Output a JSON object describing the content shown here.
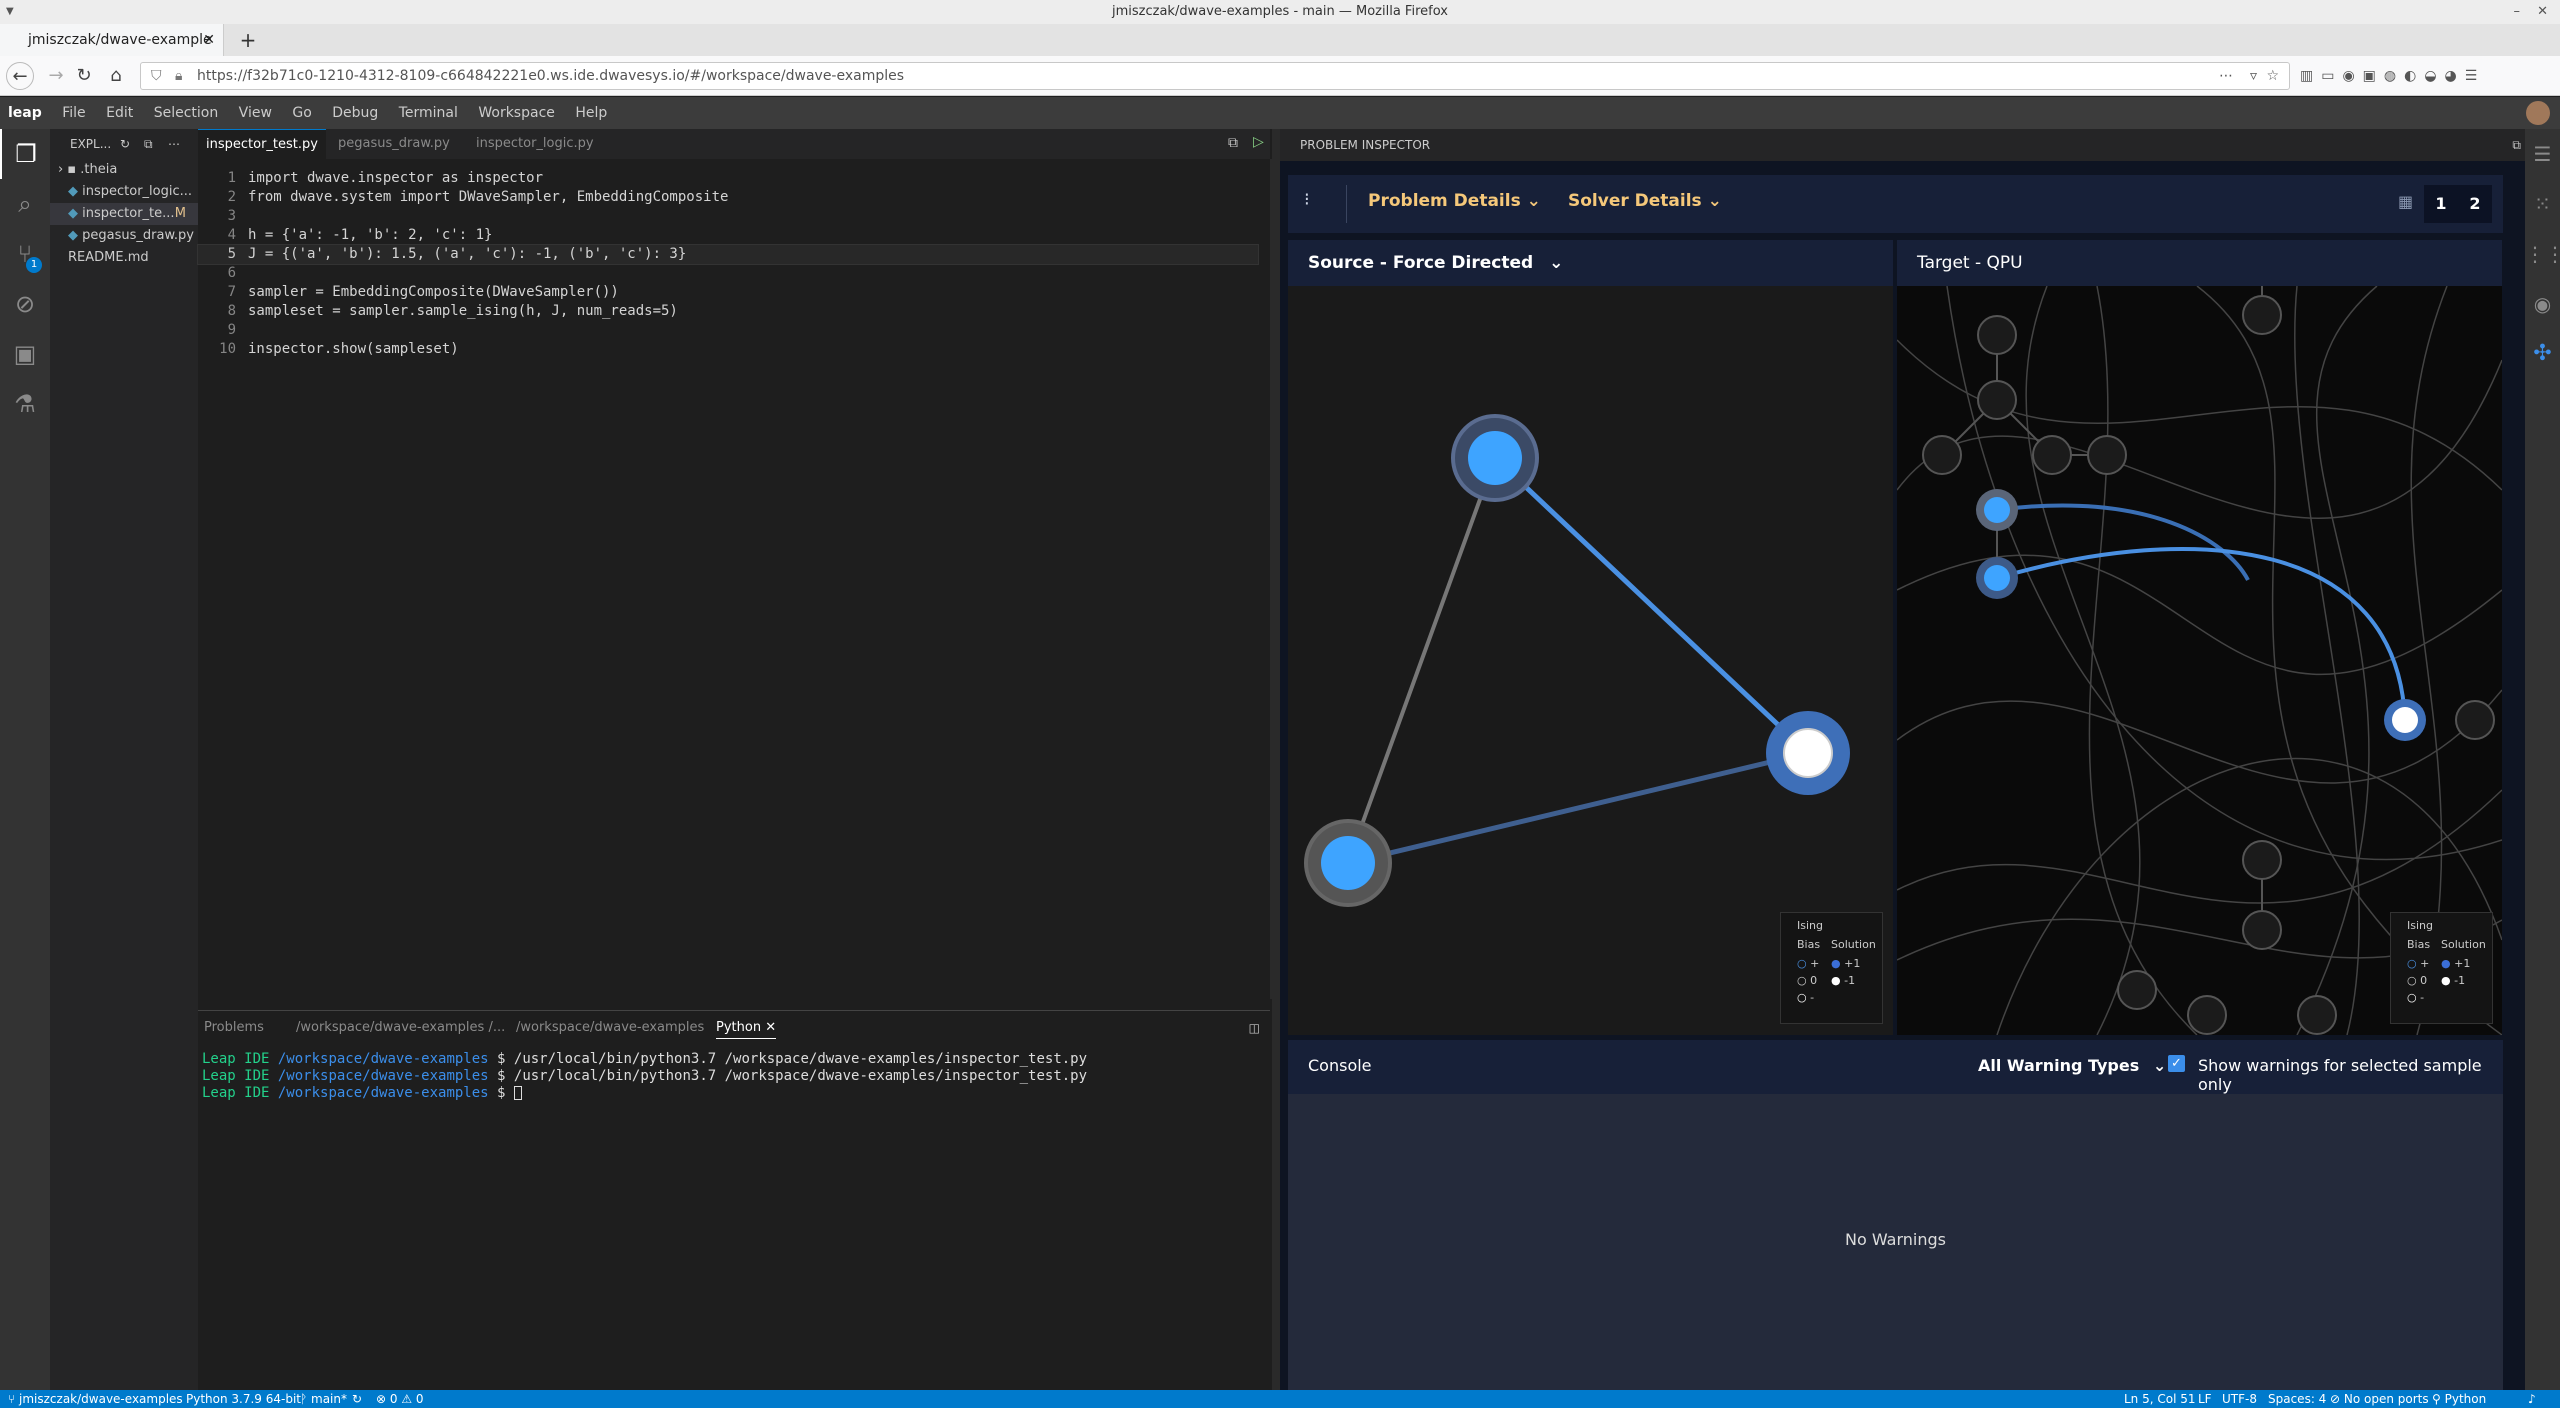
{
  "browser": {
    "window_title": "jmiszczak/dwave-examples - main — Mozilla Firefox",
    "tab_title": "jmiszczak/dwave-example",
    "url": "https://f32b71c0-1210-4312-8109-c664842221e0.ws.ide.dwavesys.io/#/workspace/dwave-examples"
  },
  "menu": [
    "File",
    "Edit",
    "Selection",
    "View",
    "Go",
    "Debug",
    "Terminal",
    "Workspace",
    "Help"
  ],
  "logo": "leap",
  "explorer": {
    "title": "EXPL...",
    "items": [
      ".theia",
      "inspector_logic...",
      "inspector_te...",
      "pegasus_draw.py",
      "README.md"
    ],
    "modified_marker": "M"
  },
  "scm_badge": "1",
  "editor": {
    "tabs": [
      "inspector_test.py",
      "pegasus_draw.py",
      "inspector_logic.py"
    ],
    "lines": [
      "import dwave.inspector as inspector",
      "from dwave.system import DWaveSampler, EmbeddingComposite",
      "",
      "h = {'a': -1, 'b': 2, 'c': 1}",
      "J = {('a', 'b'): 1.5, ('a', 'c'): -1, ('b', 'c'): 3}",
      "",
      "sampler = EmbeddingComposite(DWaveSampler())",
      "sampleset = sampler.sample_ising(h, J, num_reads=5)",
      "",
      "inspector.show(sampleset)"
    ]
  },
  "panel": {
    "tabs": [
      "Problems",
      "/workspace/dwave-examples /...",
      "/workspace/dwave-examples",
      "Python"
    ],
    "terminal": [
      {
        "prompt": "Leap IDE",
        "path": "/workspace/dwave-examples",
        "cmd": "$ /usr/local/bin/python3.7 /workspace/dwave-examples/inspector_test.py"
      },
      {
        "prompt": "Leap IDE",
        "path": "/workspace/dwave-examples",
        "cmd": "$ /usr/local/bin/python3.7 /workspace/dwave-examples/inspector_test.py"
      },
      {
        "prompt": "Leap IDE",
        "path": "/workspace/dwave-examples",
        "cmd": "$"
      }
    ]
  },
  "inspector": {
    "header": "PROBLEM INSPECTOR",
    "problem_details": "Problem Details",
    "solver_details": "Solver Details",
    "page1": "1",
    "page2": "2",
    "source_title": "Source - Force Directed",
    "target_title": "Target - QPU",
    "legend": {
      "title": "Ising",
      "bias": "Bias",
      "solution": "Solution",
      "plus": "+",
      "zero": "0",
      "minus": "-",
      "sol_plus": "+1",
      "sol_minus": "-1"
    },
    "console_title": "Console",
    "warning_types": "All Warning Types",
    "show_warnings": "Show warnings for selected sample only",
    "no_warnings": "No Warnings"
  },
  "status": {
    "repo": "jmiszczak/dwave-examples",
    "python": "Python 3.7.9 64-bit",
    "branch": "main*",
    "problems": "0",
    "warnings": "0",
    "position": "Ln 5, Col 51",
    "eol": "LF",
    "encoding": "UTF-8",
    "spaces": "Spaces: 4",
    "ports": "No open ports",
    "language": "Python"
  },
  "colors": {
    "accent": "#007acc",
    "node_blue": "#4da6ff",
    "edge_blue": "#4a90e2",
    "inspector_bg": "#172038"
  }
}
